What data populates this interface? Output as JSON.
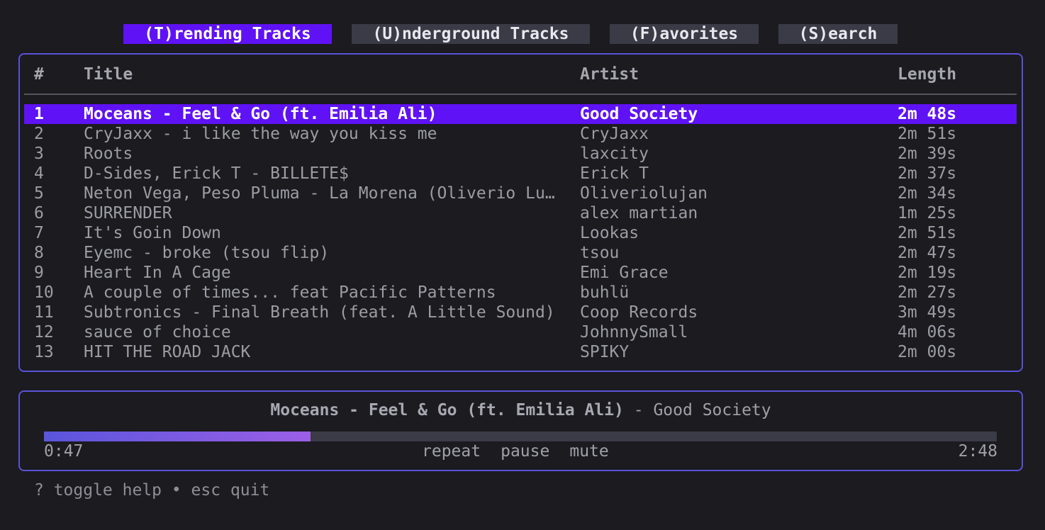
{
  "tabs": [
    {
      "label": "(T)rending Tracks",
      "active": true
    },
    {
      "label": "(U)nderground Tracks",
      "active": false
    },
    {
      "label": "(F)avorites",
      "active": false
    },
    {
      "label": "(S)earch",
      "active": false
    }
  ],
  "table": {
    "headers": {
      "num": "#",
      "title": "Title",
      "artist": "Artist",
      "length": "Length"
    },
    "selected_index": 0,
    "rows": [
      {
        "num": "1",
        "title": "Moceans - Feel & Go (ft. Emilia Ali)",
        "artist": "Good Society",
        "length": "2m 48s"
      },
      {
        "num": "2",
        "title": "CryJaxx - i like the way you kiss me",
        "artist": "CryJaxx",
        "length": "2m 51s"
      },
      {
        "num": "3",
        "title": "Roots",
        "artist": "laxcity",
        "length": "2m 39s"
      },
      {
        "num": "4",
        "title": "D-Sides, Erick T - BILLETE$",
        "artist": "Erick T",
        "length": "2m 37s"
      },
      {
        "num": "5",
        "title": "Neton Vega, Peso Pluma - La Morena (Oliverio Lu…",
        "artist": "Oliveriolujan",
        "length": "2m 34s"
      },
      {
        "num": "6",
        "title": "SURRENDER",
        "artist": "alex martian",
        "length": "1m 25s"
      },
      {
        "num": "7",
        "title": "It's Goin Down",
        "artist": "Lookas",
        "length": "2m 51s"
      },
      {
        "num": "8",
        "title": "Eyemc - broke (tsou flip)",
        "artist": "tsou",
        "length": "2m 47s"
      },
      {
        "num": "9",
        "title": "Heart In A Cage",
        "artist": "Emi Grace",
        "length": "2m 19s"
      },
      {
        "num": "10",
        "title": "A couple of times... feat Pacific Patterns",
        "artist": "buhlü",
        "length": "2m 27s"
      },
      {
        "num": "11",
        "title": "Subtronics - Final Breath (feat. A Little Sound)",
        "artist": "Coop Records",
        "length": "3m 49s"
      },
      {
        "num": "12",
        "title": "sauce of choice",
        "artist": "JohnnySmall",
        "length": "4m 06s"
      },
      {
        "num": "13",
        "title": "HIT THE ROAD JACK",
        "artist": "SPIKY",
        "length": "2m 00s"
      }
    ]
  },
  "player": {
    "title": "Moceans - Feel & Go (ft. Emilia Ali)",
    "separator": "-",
    "artist": "Good Society",
    "elapsed": "0:47",
    "total": "2:48",
    "progress": 0.28,
    "controls": [
      "repeat",
      "pause",
      "mute"
    ]
  },
  "help": "? toggle help • esc quit",
  "colors": {
    "accent": "#5f12f5",
    "border": "#5a52d6",
    "background": "#1b1b20",
    "tab_inactive": "#3a3b46"
  }
}
